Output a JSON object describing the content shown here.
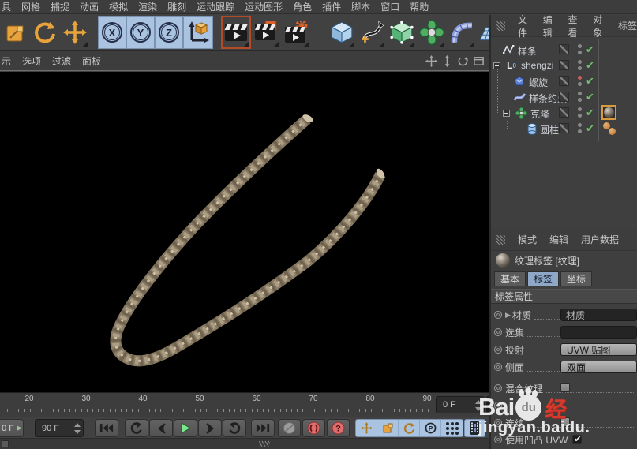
{
  "menubar": {
    "items": [
      "具",
      "网格",
      "捕捉",
      "动画",
      "模拟",
      "渲染",
      "雕刻",
      "运动跟踪",
      "运动图形",
      "角色",
      "插件",
      "脚本",
      "窗口",
      "帮助"
    ]
  },
  "toolbar": {
    "axis_labels": [
      "X",
      "Y",
      "Z"
    ],
    "tools": [
      "scale-tool",
      "rotate-tool",
      "move-tool",
      "lock-x-axis",
      "lock-y-axis",
      "lock-z-axis",
      "coordinate-system",
      "render-view",
      "render-to-picture-viewer",
      "edit-render-settings",
      "add-cube",
      "add-spline-pen",
      "add-subdivision-surface",
      "add-mograph-cloner",
      "add-bend-deformer",
      "add-floor",
      "add-camera"
    ]
  },
  "viewport": {
    "menu_items": [
      "示",
      "选项",
      "过滤",
      "面板"
    ],
    "nav": [
      "pan",
      "dolly",
      "orbit",
      "toggle-views"
    ]
  },
  "object_manager": {
    "menu_items": [
      "文件",
      "编辑",
      "查看",
      "对象",
      "标签"
    ],
    "tree": [
      {
        "label": "样条"
      },
      {
        "label": "shengzi"
      },
      {
        "label": "螺旋"
      },
      {
        "label": "样条约束"
      },
      {
        "label": "克隆"
      },
      {
        "label": "圆柱"
      }
    ]
  },
  "attributes": {
    "menu_items": [
      "模式",
      "编辑",
      "用户数据"
    ],
    "title": "纹理标签 [纹理]",
    "tabs": [
      "基本",
      "标签",
      "坐标"
    ],
    "active_tab": "标签",
    "section_title": "标签属性",
    "props": [
      {
        "label": "材质",
        "value": "材质",
        "control": "field"
      },
      {
        "label": "选集",
        "value": "",
        "control": "field"
      },
      {
        "label": "投射",
        "value": "UVW 贴图",
        "control": "dropdown"
      },
      {
        "label": "侧面",
        "value": "双面",
        "control": "dropdown"
      },
      {
        "label": "混合纹理",
        "control": "checkbox",
        "checked": false
      },
      {
        "label": "连续",
        "control": "checkbox",
        "checked": false
      },
      {
        "label": "使用凹凸 UVW",
        "control": "checkbox",
        "checked": true
      }
    ]
  },
  "timeline": {
    "tick_labels": [
      "20",
      "30",
      "40",
      "50",
      "60",
      "70",
      "80",
      "90"
    ],
    "frame_field": "0 F"
  },
  "transport": {
    "current_frame": "0 F",
    "end_frame": "90 F"
  },
  "watermark": {
    "brand_prefix": "Bai",
    "brand_suffix": "du",
    "brand_cn": "经",
    "site": "jingyan.baidu."
  },
  "colors": {
    "accent_orange": "#e8a33d",
    "axis_blue": "#a9c3e0",
    "check_green": "#6fbf6f",
    "record_red": "#e06d6d",
    "rope_base": "#8a7b64",
    "tab_active": "#8fa8c8",
    "viewport_bg": "#000000"
  }
}
